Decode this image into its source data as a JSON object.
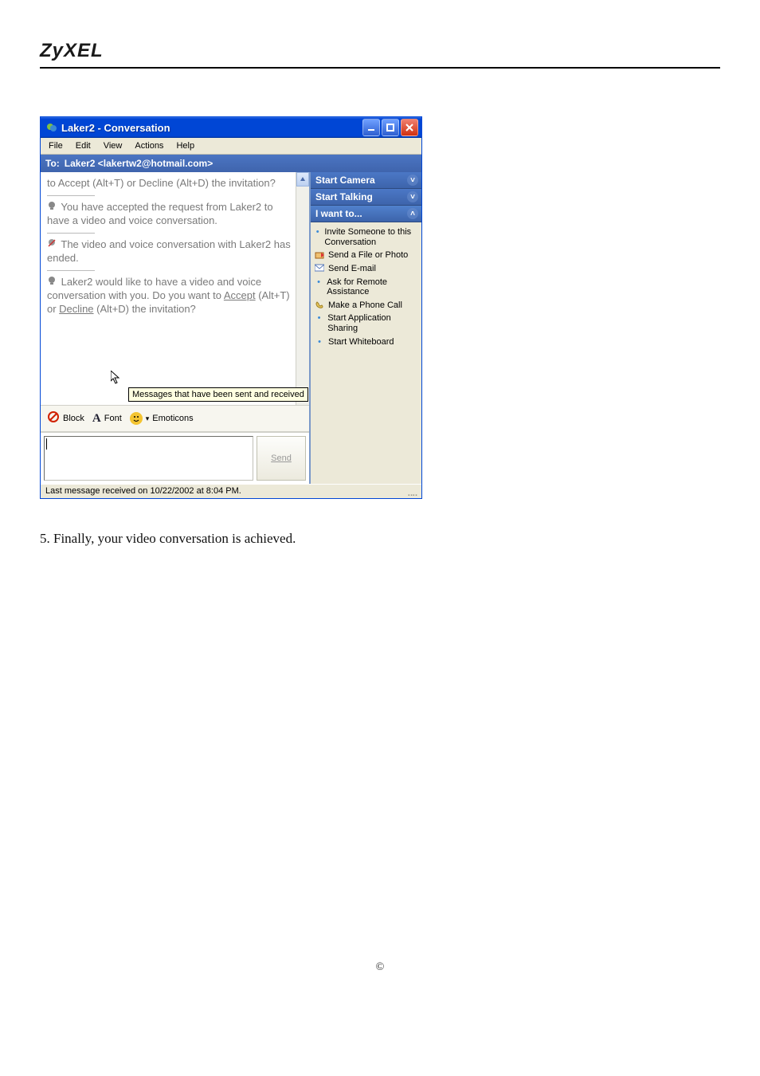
{
  "doc": {
    "brand": "ZyXEL",
    "caption": "5. Finally, your video conversation is achieved.",
    "footer": "©"
  },
  "window": {
    "title": "Laker2 - Conversation",
    "menus": [
      "File",
      "Edit",
      "View",
      "Actions",
      "Help"
    ],
    "to_label": "To:",
    "to_value": "Laker2 <lakertw2@hotmail.com>",
    "conversation": {
      "line1": "to Accept (Alt+T) or Decline (Alt+D) the invitation?",
      "line2": "You have accepted the request from Laker2 to have a video and voice conversation.",
      "line3": "The video and voice conversation with Laker2 has ended.",
      "line4_pre": "Laker2 would like to have a video and voice conversation with you. Do you want to ",
      "accept": "Accept",
      "mid": " (Alt+T) or ",
      "decline": "Decline",
      "line4_post": " (Alt+D) the invitation?",
      "tooltip": "Messages that have been sent and received"
    },
    "toolbar": {
      "block": "Block",
      "font": "Font",
      "emoticons": "Emoticons"
    },
    "send": "Send",
    "statusbar": "Last message received on 10/22/2002 at 8:04 PM."
  },
  "side": {
    "start_camera": "Start Camera",
    "start_talking": "Start Talking",
    "i_want_to": "I want to...",
    "items": [
      "Invite Someone to this Conversation",
      "Send a File or Photo",
      "Send E-mail",
      "Ask for Remote Assistance",
      "Make a Phone Call",
      "Start Application Sharing",
      "Start Whiteboard"
    ]
  },
  "icons": {
    "chevdown": "˅",
    "chevup": "˄",
    "bullet": "•",
    "phone": "📞",
    "mail": "✉",
    "file": "🗀",
    "cam": "🕊",
    "block": "⦸",
    "fontA": "A",
    "smile": "☺",
    "tri": "▾"
  }
}
